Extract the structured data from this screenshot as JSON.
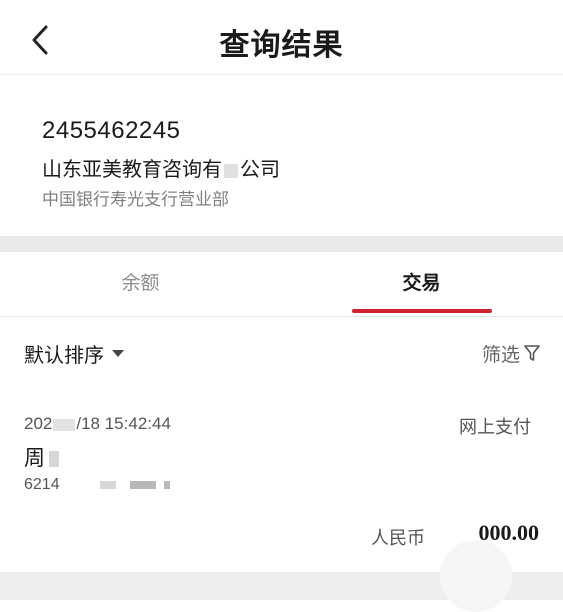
{
  "header": {
    "title": "查询结果"
  },
  "account": {
    "number": "2455462245",
    "name": "山东亚美教育咨询有",
    "name_suffix": "公司",
    "bank": "中国银行寿光支行营业部"
  },
  "tabs": [
    {
      "label": "余额",
      "active": false
    },
    {
      "label": "交易",
      "active": true
    }
  ],
  "toolbar": {
    "sort_label": "默认排序",
    "filter_label": "筛选"
  },
  "transactions": [
    {
      "date_start": "202",
      "date_end": "/18 15:42:44",
      "type": "网上支付",
      "payer": "周",
      "card": "6214",
      "currency": "人民币",
      "amount": "000.00"
    }
  ],
  "colors": {
    "accent": "#d0222e",
    "separator": "#eaeaea"
  }
}
